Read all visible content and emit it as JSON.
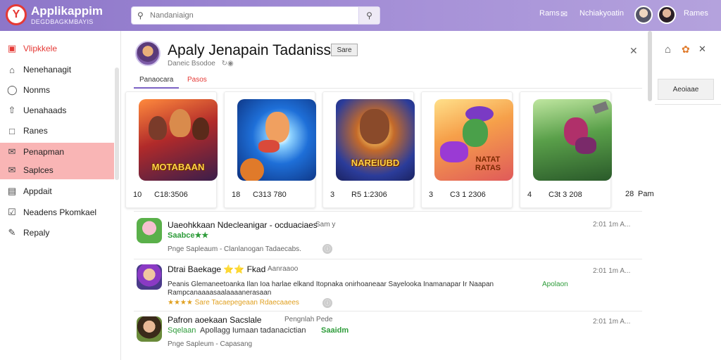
{
  "header": {
    "logo_text": "Applikappim",
    "logo_subtitle": "DEGDBAGKMBAYIS",
    "search_placeholder": "Nandaniaign",
    "nav_left": "Rams",
    "nav_right": "Nchiakyoatin",
    "user_label": "Rames"
  },
  "sidebar": {
    "items": [
      {
        "label": "Vlipkkele",
        "icon": "app-icon"
      },
      {
        "label": "Nenehanagit",
        "icon": "home-icon"
      },
      {
        "label": "Nonms",
        "icon": "pin-icon"
      },
      {
        "label": "Uenahaads",
        "icon": "upload-icon"
      },
      {
        "label": "Ranes",
        "icon": "square-icon"
      },
      {
        "label": "Penapman",
        "icon": "mail-icon"
      },
      {
        "label": "Saplces",
        "icon": "mail-icon"
      },
      {
        "label": "Appdait",
        "icon": "document-icon"
      },
      {
        "label": "Neadens Pkomkael",
        "icon": "check-icon"
      },
      {
        "label": "Repaly",
        "icon": "edit-icon"
      }
    ]
  },
  "detail": {
    "title": "Apaly Jenapain Tadaniss",
    "badge": "Sare",
    "subtitle": "Daneic Bsodoe",
    "tabs": [
      "Panaocara",
      "Pasos"
    ]
  },
  "cards": [
    {
      "num": "10",
      "price": "C18:3506",
      "art_title": "MOTABAAN"
    },
    {
      "num": "18",
      "price": "C313 780",
      "art_title": ""
    },
    {
      "num": "3",
      "price": "R5 1:2306",
      "art_title": "NAREIUBD"
    },
    {
      "num": "3",
      "price": "C3 1 2306",
      "art_title": "NATAT RATAS"
    },
    {
      "num": "4",
      "price": "C3t 3 208",
      "art_title": ""
    },
    {
      "num": "28",
      "price": "Pam",
      "art_title": ""
    }
  ],
  "list": [
    {
      "title": "Uaeohkkaan Ndecleanigar - ocduaciaes",
      "title_suffix": "Sam y",
      "green": "Saabce★★",
      "meta": "Pnge Sapleaum - Clanlanogan Tadaecabs.",
      "time": "2:01 1m A..."
    },
    {
      "title": "Dtrai Baekage ⭐⭐ Fkad",
      "title_suffix": "Aanraaoo",
      "body_line1": "Peanis Glemaneetoanka Ilan Ioa harlae elkand Itopnaka onirhoaneaar Sayelooka Inamanapar Ir Naapan",
      "body_green": "Apolaon",
      "body_line2": "Rampcanaaaasaalaaaanerasaan",
      "meta": "★★★★ Sare Tacaepegeaan Rdaecaaees",
      "time": "2:01 1m A..."
    },
    {
      "title": "Pafron aoekaan Sacslale",
      "title_suffix": "Pengnlah Pede",
      "green": "Sqelaan",
      "body": "Apollagg Iumaan tadanacictian",
      "green_end": "Saaidm",
      "meta": "Pnge Sapleum - Capasang",
      "time": "2:01 1m A..."
    }
  ],
  "right_panel": {
    "button_label": "Aeoiaae"
  },
  "colors": {
    "accent": "#8d76c9",
    "highlight": "#f9b5b5",
    "green": "#2e9c3a",
    "red": "#e53935"
  }
}
